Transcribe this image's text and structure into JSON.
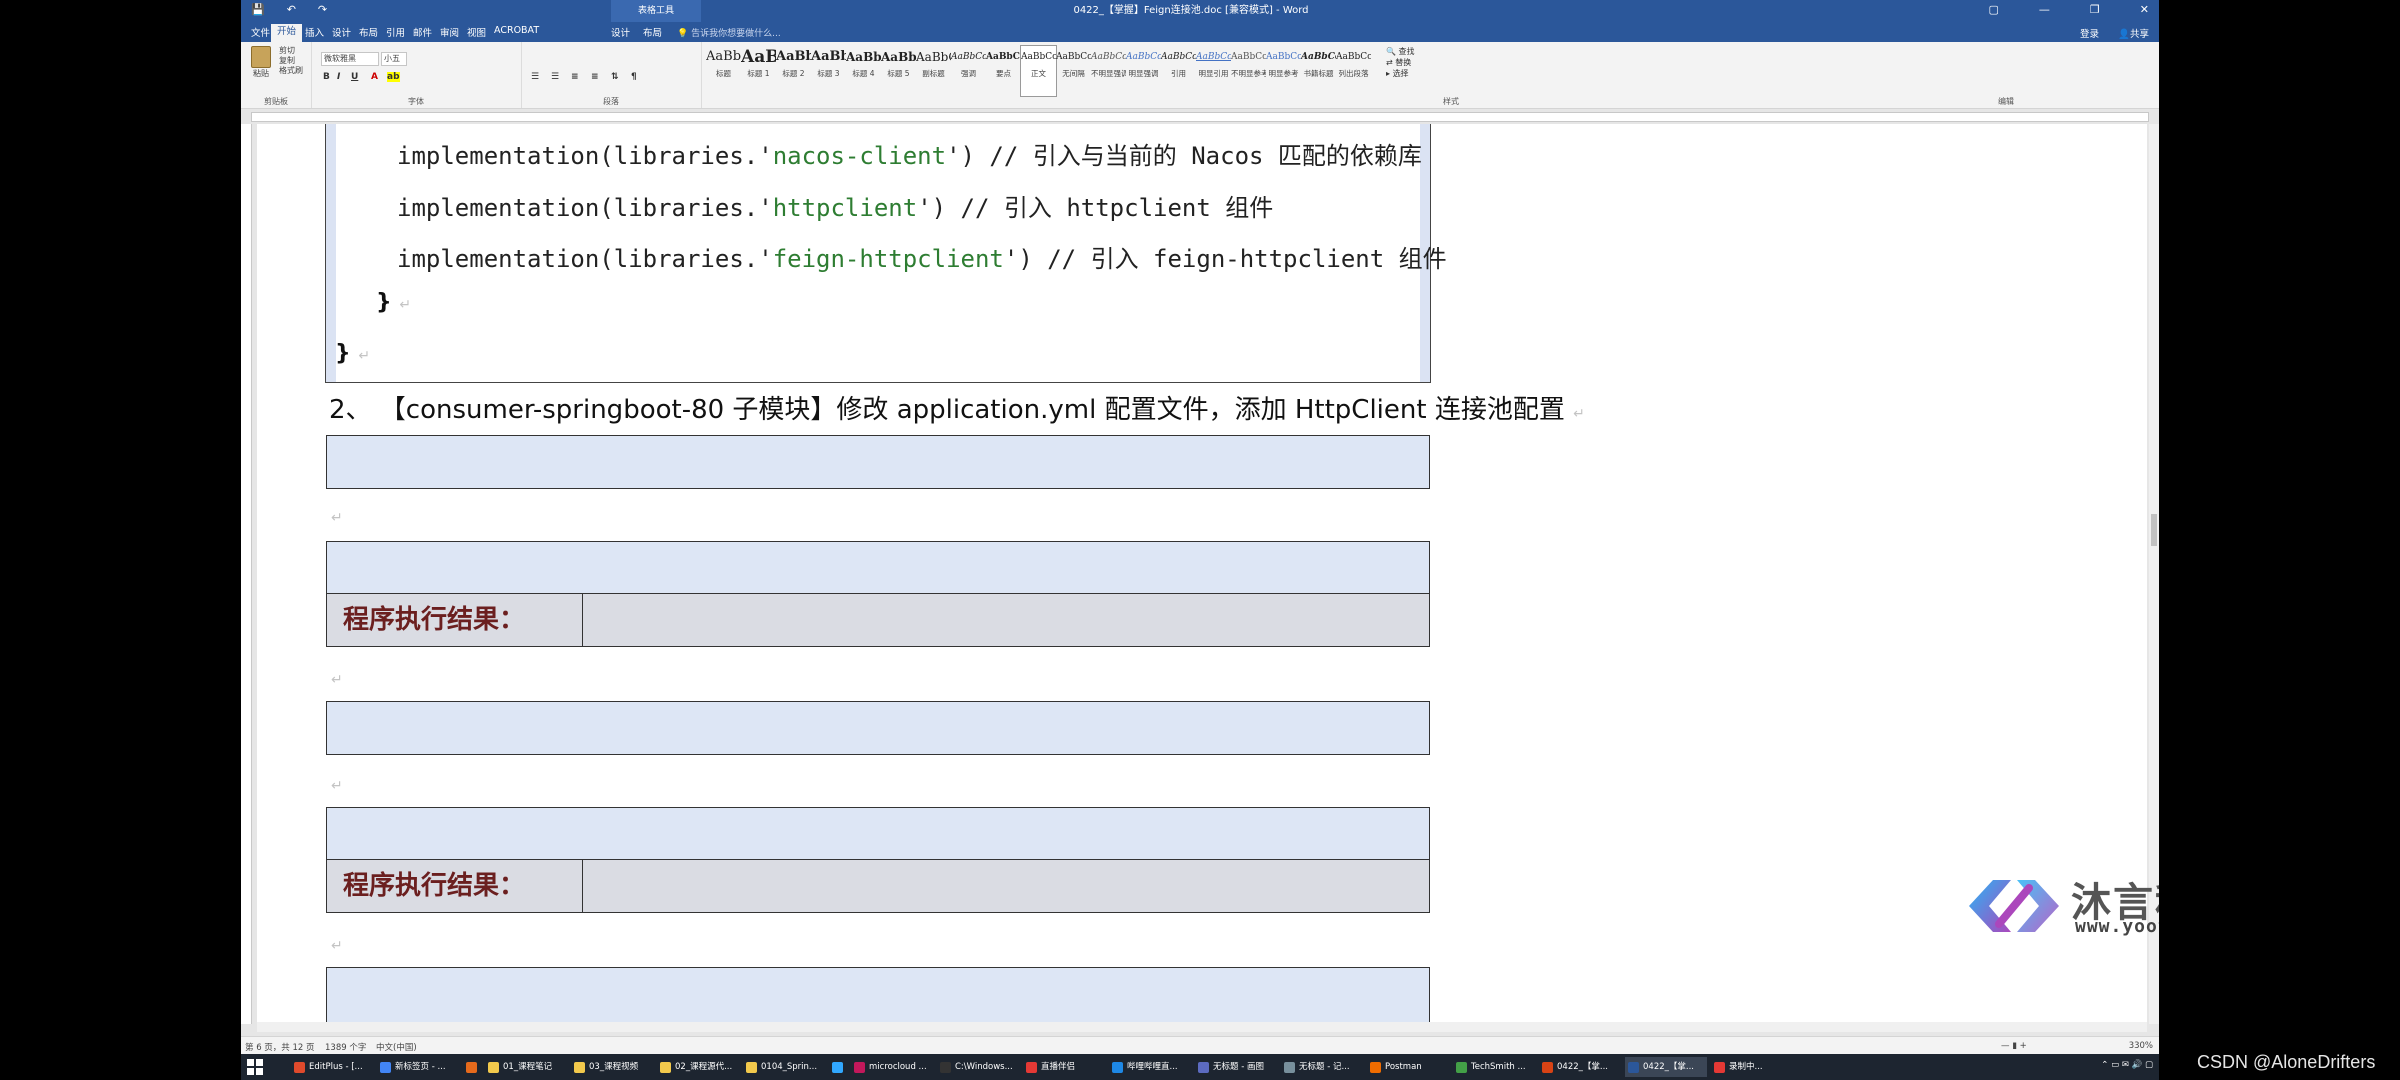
{
  "window": {
    "title": "0422_【掌握】Feign连接池.doc [兼容模式] - Word",
    "context_tab": "表格工具",
    "quick_access": [
      "💾",
      "↶",
      "↷"
    ],
    "controls": [
      "▢",
      "—",
      "❐",
      "✕"
    ]
  },
  "tabs": [
    {
      "label": "文件"
    },
    {
      "label": "开始"
    },
    {
      "label": "插入"
    },
    {
      "label": "设计"
    },
    {
      "label": "布局"
    },
    {
      "label": "引用"
    },
    {
      "label": "邮件"
    },
    {
      "label": "审阅"
    },
    {
      "label": "视图"
    },
    {
      "label": "ACROBAT"
    },
    {
      "label": "设计"
    },
    {
      "label": "布局"
    }
  ],
  "tell_me": "告诉我你想要做什么...",
  "account": {
    "login": "登录",
    "share": "共享"
  },
  "ribbon": {
    "clipboard": {
      "paste": "粘贴",
      "cut": "剪切",
      "copy": "复制",
      "format_painter": "格式刷",
      "label": "剪贴板"
    },
    "font": {
      "name": "微软雅黑",
      "size": "小五",
      "label": "字体"
    },
    "paragraph": {
      "label": "段落"
    },
    "styles_label": "样式",
    "styles": [
      {
        "preview": "AaBbC",
        "name": "标题"
      },
      {
        "preview": "AaBl",
        "name": "标题 1"
      },
      {
        "preview": "AaBbC",
        "name": "标题 2"
      },
      {
        "preview": "AaBbC",
        "name": "标题 3"
      },
      {
        "preview": "AaBbC",
        "name": "标题 4"
      },
      {
        "preview": "AaBbC",
        "name": "标题 5"
      },
      {
        "preview": "AaBbC",
        "name": "副标题"
      },
      {
        "preview": "AaBbCcDc",
        "name": "强调"
      },
      {
        "preview": "AaBbCcD",
        "name": "要点"
      },
      {
        "preview": "AaBbCcDc",
        "name": "正文"
      },
      {
        "preview": "AaBbCcDc",
        "name": "无间隔"
      },
      {
        "preview": "AaBbCcDc",
        "name": "不明显强调"
      },
      {
        "preview": "AaBbCcDc",
        "name": "明显强调"
      },
      {
        "preview": "AaBbCcDc",
        "name": "引用"
      },
      {
        "preview": "AaBbCcDc",
        "name": "明显引用"
      },
      {
        "preview": "AaBbCcD",
        "name": "不明显参考"
      },
      {
        "preview": "AaBbCcI",
        "name": "明显参考"
      },
      {
        "preview": "AaBbCcD",
        "name": "书籍标题"
      },
      {
        "preview": "AaBbCcDc",
        "name": "列出段落"
      }
    ],
    "editing": {
      "find": "查找",
      "replace": "替换",
      "select": "选择",
      "label": "编辑"
    }
  },
  "document": {
    "code_lines": [
      {
        "prefix": "implementation(libraries.'",
        "lib": "nacos-client",
        "suffix": "') // 引入与当前的 Nacos 匹配的依赖库"
      },
      {
        "prefix": "implementation(libraries.'",
        "lib": "httpclient",
        "suffix": "') // 引入 httpclient 组件"
      },
      {
        "prefix": "implementation(libraries.'",
        "lib": "feign-httpclient",
        "suffix": "') // 引入 feign-httpclient 组件"
      }
    ],
    "inner_brace": "}",
    "outer_brace": "}",
    "paragraph_mark": "↵",
    "heading": "2、 【consumer-springboot-80 子模块】修改 application.yml 配置文件，添加 HttpClient 连接池配置",
    "result_label_1": "程序执行结果：",
    "result_label_2": "程序执行结果："
  },
  "status": {
    "page": "第 6 页，共 12 页",
    "words": "1389 个字",
    "language": "中文(中国)",
    "zoom": "330%"
  },
  "taskbar": [
    {
      "label": "EditPlus - [...",
      "color": "#e04a2c"
    },
    {
      "label": "新标签页 - ...",
      "color": "#4285f4"
    },
    {
      "label": "",
      "color": "#e66a1c"
    },
    {
      "label": "01_课程笔记",
      "color": "#f2c94c"
    },
    {
      "label": "03_课程视频",
      "color": "#f2c94c"
    },
    {
      "label": "02_课程源代...",
      "color": "#f2c94c"
    },
    {
      "label": "0104_Sprin...",
      "color": "#f2c94c"
    },
    {
      "label": "",
      "color": "#31a8ff"
    },
    {
      "label": "microcloud ...",
      "color": "#c2185b"
    },
    {
      "label": "C:\\Windows...",
      "color": "#333333"
    },
    {
      "label": "直播伴侣",
      "color": "#e53935"
    },
    {
      "label": "哔哩哔哩直...",
      "color": "#1e88e5"
    },
    {
      "label": "无标题 - 画图",
      "color": "#5c6bc0"
    },
    {
      "label": "无标题 - 记...",
      "color": "#78909c"
    },
    {
      "label": "Postman",
      "color": "#ef6c00"
    },
    {
      "label": "TechSmith ...",
      "color": "#43a047"
    },
    {
      "label": "0422_【掌...",
      "color": "#d84315"
    },
    {
      "label": "0422_【掌...",
      "color": "#2b579a"
    },
    {
      "label": "录制中...",
      "color": "#e53935"
    }
  ],
  "watermark": {
    "name": "沐言科技",
    "url": "www.yootk.com"
  },
  "csdn": "CSDN @AloneDrifters"
}
